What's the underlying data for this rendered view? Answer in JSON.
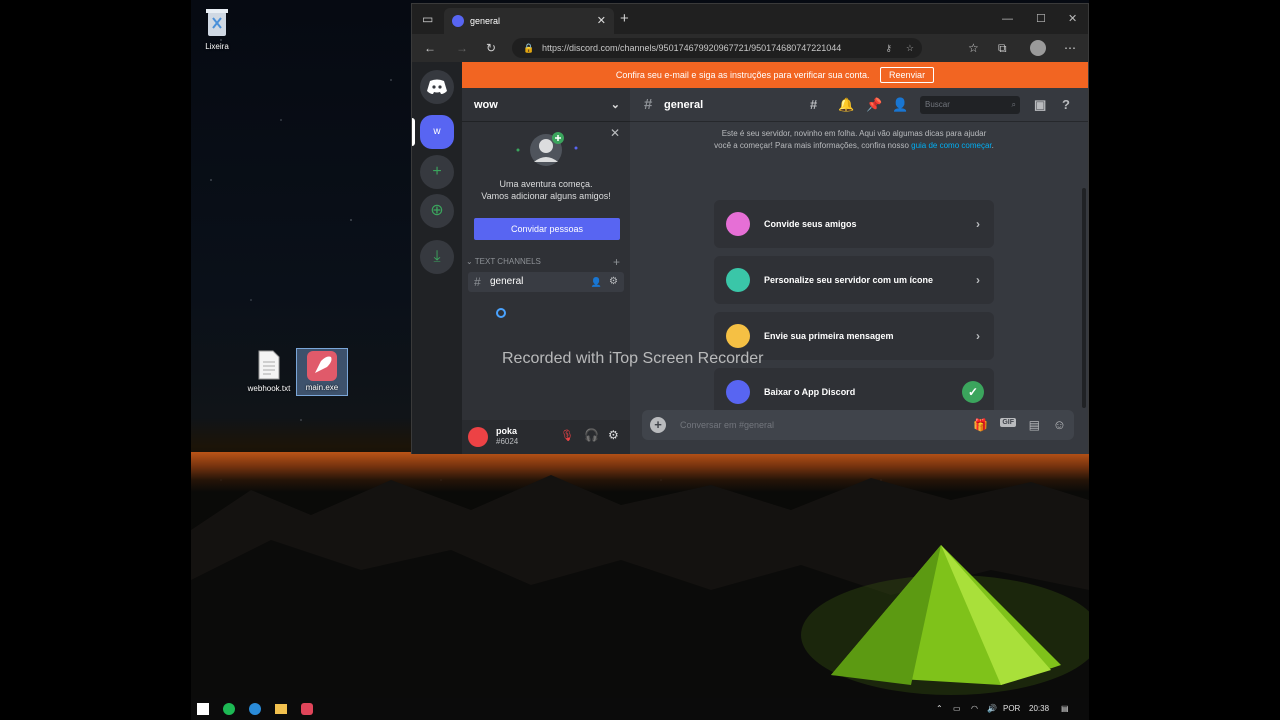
{
  "desktop": {
    "icons": [
      {
        "label": "Lixeira"
      },
      {
        "label": "webhook.txt"
      },
      {
        "label": "main.exe"
      }
    ]
  },
  "browser": {
    "tab_title": "general",
    "url": "https://discord.com/channels/950174679920967721/950174680747221044"
  },
  "discord": {
    "banner": {
      "text": "Confira seu e-mail e siga as instruções para verificar sua conta.",
      "button": "Reenviar"
    },
    "server_initial": "w",
    "server_name": "wow",
    "invite_card": {
      "line1": "Uma aventura começa.",
      "line2": "Vamos adicionar alguns amigos!",
      "button": "Convidar pessoas"
    },
    "category": "TEXT CHANNELS",
    "channel": "general",
    "user": {
      "name": "poka",
      "tag": "#6024"
    },
    "header": {
      "channel": "general",
      "search_placeholder": "Buscar"
    },
    "welcome": {
      "text": "Este é seu servidor, novinho em folha. Aqui vão algumas dicas para ajudar você a começar! Para mais informações, confira nosso",
      "link": "guia de como começar",
      "end": "."
    },
    "cards": [
      {
        "label": "Convide seus amigos",
        "color": "#e66fd6"
      },
      {
        "label": "Personalize seu servidor com um ícone",
        "color": "#3ac6a8"
      },
      {
        "label": "Envie sua primeira mensagem",
        "color": "#f5c044"
      },
      {
        "label": "Baixar o App Discord",
        "color": "#5865f2"
      }
    ],
    "composer_placeholder": "Conversar em #general",
    "gif_label": "GIF"
  },
  "overlay": {
    "watermark": "Recorded with iTop Screen Recorder"
  },
  "taskbar": {
    "lang": "POR",
    "time": "20:38"
  },
  "colors": {
    "blurple": "#5865f2",
    "orange_banner": "#f26522",
    "green": "#3ba55d"
  }
}
